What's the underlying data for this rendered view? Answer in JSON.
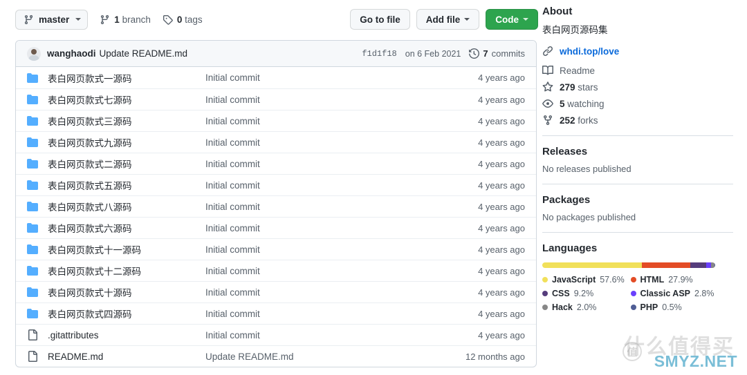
{
  "toolbar": {
    "branch_label": "master",
    "branch_count": "1",
    "branch_word": "branch",
    "tag_count": "0",
    "tag_word": "tags",
    "go_to_file": "Go to file",
    "add_file": "Add file",
    "code": "Code"
  },
  "commit_bar": {
    "author": "wanghaodi",
    "message": "Update README.md",
    "sha": "f1d1f18",
    "date": "on 6 Feb 2021",
    "commits_count": "7",
    "commits_label": "commits"
  },
  "files": [
    {
      "type": "folder",
      "name": "表白网页款式一源码",
      "message": "Initial commit",
      "age": "4 years ago"
    },
    {
      "type": "folder",
      "name": "表白网页款式七源码",
      "message": "Initial commit",
      "age": "4 years ago"
    },
    {
      "type": "folder",
      "name": "表白网页款式三源码",
      "message": "Initial commit",
      "age": "4 years ago"
    },
    {
      "type": "folder",
      "name": "表白网页款式九源码",
      "message": "Initial commit",
      "age": "4 years ago"
    },
    {
      "type": "folder",
      "name": "表白网页款式二源码",
      "message": "Initial commit",
      "age": "4 years ago"
    },
    {
      "type": "folder",
      "name": "表白网页款式五源码",
      "message": "Initial commit",
      "age": "4 years ago"
    },
    {
      "type": "folder",
      "name": "表白网页款式八源码",
      "message": "Initial commit",
      "age": "4 years ago"
    },
    {
      "type": "folder",
      "name": "表白网页款式六源码",
      "message": "Initial commit",
      "age": "4 years ago"
    },
    {
      "type": "folder",
      "name": "表白网页款式十一源码",
      "message": "Initial commit",
      "age": "4 years ago"
    },
    {
      "type": "folder",
      "name": "表白网页款式十二源码",
      "message": "Initial commit",
      "age": "4 years ago"
    },
    {
      "type": "folder",
      "name": "表白网页款式十源码",
      "message": "Initial commit",
      "age": "4 years ago"
    },
    {
      "type": "folder",
      "name": "表白网页款式四源码",
      "message": "Initial commit",
      "age": "4 years ago"
    },
    {
      "type": "file",
      "name": ".gitattributes",
      "message": "Initial commit",
      "age": "4 years ago"
    },
    {
      "type": "file",
      "name": "README.md",
      "message": "Update README.md",
      "age": "12 months ago"
    }
  ],
  "about": {
    "heading": "About",
    "description": "表白网页源码集",
    "homepage": "whdi.top/love",
    "readme_label": "Readme",
    "stars_count": "279",
    "stars_label": "stars",
    "watching_count": "5",
    "watching_label": "watching",
    "forks_count": "252",
    "forks_label": "forks"
  },
  "releases": {
    "heading": "Releases",
    "empty": "No releases published"
  },
  "packages": {
    "heading": "Packages",
    "empty": "No packages published"
  },
  "languages": {
    "heading": "Languages",
    "items": [
      {
        "name": "JavaScript",
        "percent": "57.6%",
        "value": 57.6,
        "color": "#f1e05a"
      },
      {
        "name": "HTML",
        "percent": "27.9%",
        "value": 27.9,
        "color": "#e34c26"
      },
      {
        "name": "CSS",
        "percent": "9.2%",
        "value": 9.2,
        "color": "#563d7c"
      },
      {
        "name": "Classic ASP",
        "percent": "2.8%",
        "value": 2.8,
        "color": "#6a40fd"
      },
      {
        "name": "Hack",
        "percent": "2.0%",
        "value": 2.0,
        "color": "#878787"
      },
      {
        "name": "PHP",
        "percent": "0.5%",
        "value": 0.5,
        "color": "#4F5D95"
      }
    ]
  },
  "watermark": {
    "site": "SMYZ.NET",
    "chinese": "什么值得买",
    "badge": "值"
  },
  "colors": {
    "accent": "#0969da",
    "green": "#2da44e",
    "folder_blue": "#54aeff",
    "border": "#d0d7de"
  }
}
